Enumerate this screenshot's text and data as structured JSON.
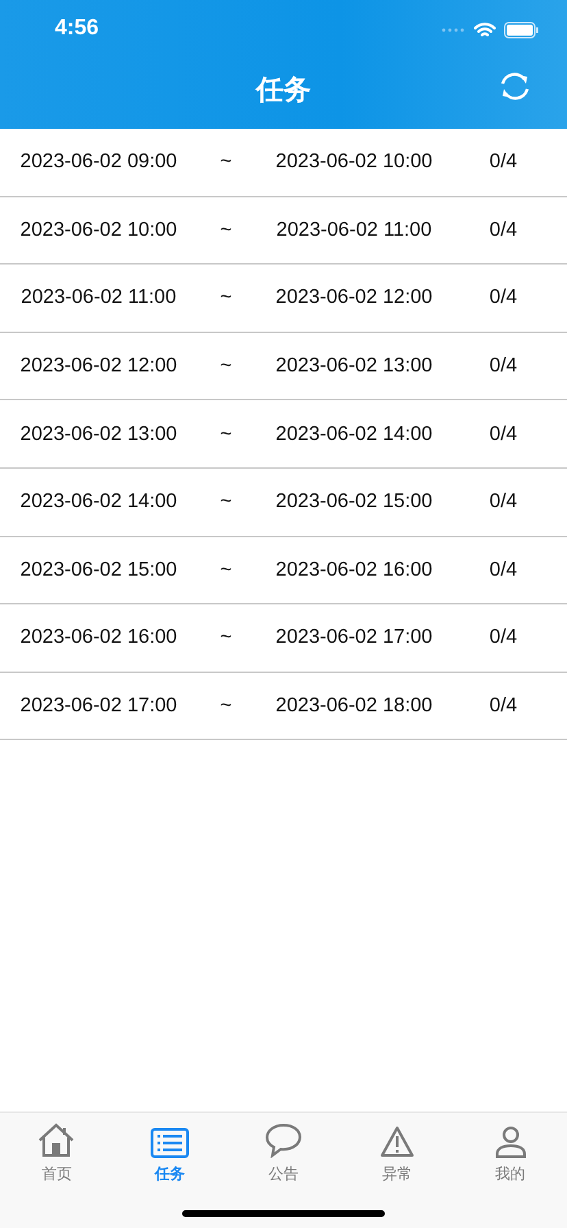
{
  "status_bar": {
    "time": "4:56"
  },
  "nav": {
    "title": "任务"
  },
  "tasks": [
    {
      "start": "2023-06-02 09:00",
      "sep": "~",
      "end": "2023-06-02 10:00",
      "count": "0/4"
    },
    {
      "start": "2023-06-02 10:00",
      "sep": "~",
      "end": "2023-06-02 11:00",
      "count": "0/4"
    },
    {
      "start": "2023-06-02 11:00",
      "sep": "~",
      "end": "2023-06-02 12:00",
      "count": "0/4"
    },
    {
      "start": "2023-06-02 12:00",
      "sep": "~",
      "end": "2023-06-02 13:00",
      "count": "0/4"
    },
    {
      "start": "2023-06-02 13:00",
      "sep": "~",
      "end": "2023-06-02 14:00",
      "count": "0/4"
    },
    {
      "start": "2023-06-02 14:00",
      "sep": "~",
      "end": "2023-06-02 15:00",
      "count": "0/4"
    },
    {
      "start": "2023-06-02 15:00",
      "sep": "~",
      "end": "2023-06-02 16:00",
      "count": "0/4"
    },
    {
      "start": "2023-06-02 16:00",
      "sep": "~",
      "end": "2023-06-02 17:00",
      "count": "0/4"
    },
    {
      "start": "2023-06-02 17:00",
      "sep": "~",
      "end": "2023-06-02 18:00",
      "count": "0/4"
    }
  ],
  "tab_bar": [
    {
      "kind": "home",
      "label": "首页",
      "selected": false
    },
    {
      "kind": "list",
      "label": "任务",
      "selected": true
    },
    {
      "kind": "chat",
      "label": "公告",
      "selected": false
    },
    {
      "kind": "warning",
      "label": "异常",
      "selected": false
    },
    {
      "kind": "person",
      "label": "我的",
      "selected": false
    }
  ]
}
